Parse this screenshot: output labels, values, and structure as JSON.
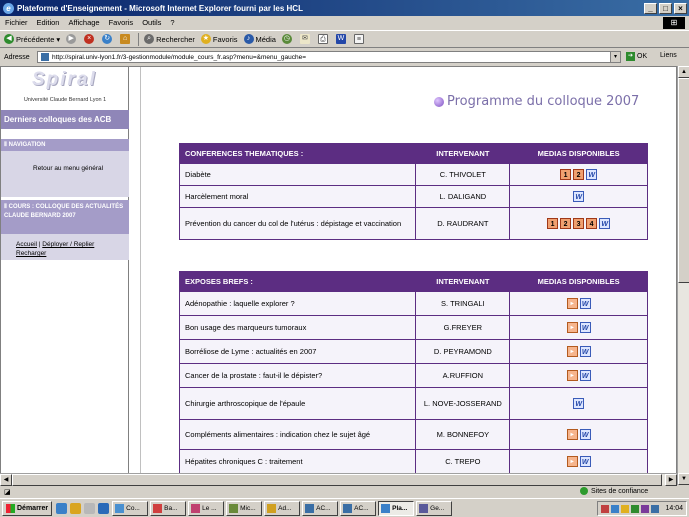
{
  "window": {
    "title": "Plateforme d'Enseignement - Microsoft Internet Explorer fourni par les HCL",
    "minimize": "_",
    "maximize": "□",
    "close": "×"
  },
  "menu": {
    "items": [
      "Fichier",
      "Edition",
      "Affichage",
      "Favoris",
      "Outils",
      "?"
    ]
  },
  "toolbar": {
    "back_label": "Précédente",
    "search_label": "Rechercher",
    "favorites_label": "Favoris",
    "media_label": "Média"
  },
  "address": {
    "label": "Adresse",
    "url": "http://spiral.univ-lyon1.fr/3-gestionmodule/module_cours_fr.asp?menu=&menu_gauche=",
    "go_label": "OK",
    "links_label": "Liens"
  },
  "sidebar": {
    "logo_text": "Spiral",
    "university": "Université Claude Bernard Lyon 1",
    "header": "Derniers colloques des ACB",
    "nav_title": "NAVIGATION",
    "nav_link": "Retour au menu général",
    "cours_title": "COURS : COLLOQUE DES ACTUALITÉS CLAUDE BERNARD 2007",
    "link_home": "Accueil",
    "link_toggle": "Déployer / Replier",
    "link_reload": "Recharger"
  },
  "content": {
    "page_title": "Programme du colloque 2007",
    "table1": {
      "headers": [
        "CONFERENCES THEMATIQUES :",
        "INTERVENANT",
        "MEDIAS DISPONIBLES"
      ],
      "rows": [
        {
          "title": "Diabète",
          "speaker": "C. THIVOLET",
          "media": [
            "1",
            "2",
            "W"
          ]
        },
        {
          "title": "Harcèlement moral",
          "speaker": "L. DALIGAND",
          "media": [
            "W"
          ]
        },
        {
          "title": "Prévention du cancer du col de l'utérus : dépistage et vaccination",
          "speaker": "D. RAUDRANT",
          "media": [
            "1",
            "2",
            "3",
            "4",
            "W"
          ]
        }
      ]
    },
    "table2": {
      "headers": [
        "EXPOSES BREFS :",
        "INTERVENANT",
        "MEDIAS DISPONIBLES"
      ],
      "rows": [
        {
          "title": "Adénopathie : laquelle explorer ?",
          "speaker": "S. TRINGALI",
          "media": [
            "P",
            "W"
          ]
        },
        {
          "title": "Bon usage des marqueurs tumoraux",
          "speaker": "G.FREYER",
          "media": [
            "P",
            "W"
          ]
        },
        {
          "title": "Borréliose de Lyme : actualités en 2007",
          "speaker": "D. PEYRAMOND",
          "media": [
            "P",
            "W"
          ]
        },
        {
          "title": "Cancer de la prostate : faut-il le dépister?",
          "speaker": "A.RUFFION",
          "media": [
            "P",
            "W"
          ]
        },
        {
          "title": "Chirurgie arthroscopique de l'épaule",
          "speaker": "L. NOVE-JOSSERAND",
          "media": [
            "W"
          ]
        },
        {
          "title": "Compléments alimentaires : indication chez le sujet âgé",
          "speaker": "M. BONNEFOY",
          "media": [
            "P",
            "W"
          ]
        },
        {
          "title": "Hépatites chroniques C : traitement",
          "speaker": "C. TREPO",
          "media": [
            "P",
            "W"
          ]
        }
      ]
    }
  },
  "status": {
    "trust_label": "Sites de confiance"
  },
  "taskbar": {
    "start_label": "Démarrer",
    "tasks": [
      "Co...",
      "Ba...",
      "Le ...",
      "Mic...",
      "Ad...",
      "AC...",
      "AC...",
      "Pla...",
      "Ge..."
    ],
    "clock": "14:04"
  }
}
